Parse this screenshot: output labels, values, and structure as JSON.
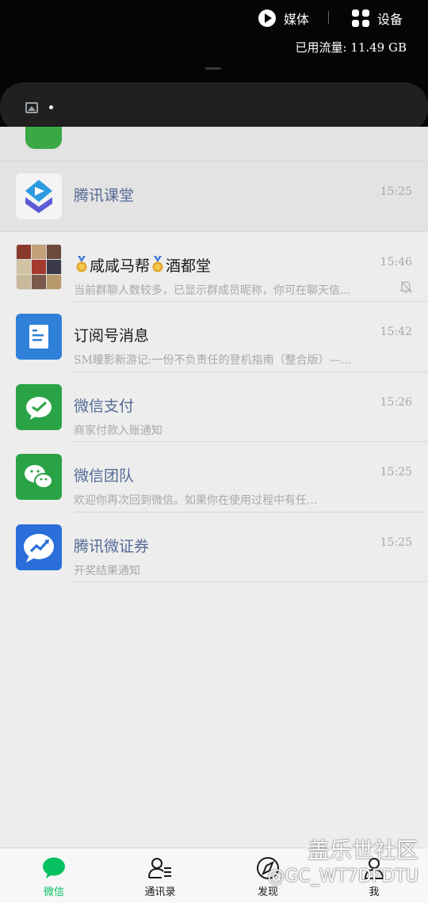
{
  "quick_panel": {
    "media_label": "媒体",
    "device_label": "设备",
    "traffic_text": "已用流量: 11.49 GB"
  },
  "chats": [
    {
      "title": "腾讯课堂",
      "time": "15:25",
      "preview": "",
      "title_style": "service",
      "pinned": true,
      "avatar": "tencent-classroom-icon"
    },
    {
      "title": "咸咸马帮",
      "title_suffix": "酒都堂",
      "time": "15:46",
      "preview": "当前群聊人数较多，已显示群成员昵称，你可在聊天信...",
      "title_style": "normal",
      "muted": true,
      "avatar": "group-avatar-icon"
    },
    {
      "title": "订阅号消息",
      "time": "15:42",
      "preview": "SM瞳影新游记:一份不负责任的登机指南（整合版）—...",
      "title_style": "normal",
      "avatar": "subscription-icon"
    },
    {
      "title": "微信支付",
      "time": "15:26",
      "preview": "商家付款入账通知",
      "title_style": "service",
      "avatar": "wechat-pay-icon"
    },
    {
      "title": "微信团队",
      "time": "15:25",
      "preview": "欢迎你再次回到微信。如果你在使用过程中有任...",
      "title_style": "service",
      "avatar": "wechat-team-icon"
    },
    {
      "title": "腾讯微证券",
      "time": "15:25",
      "preview": "开奖结果通知",
      "title_style": "service",
      "avatar": "tencent-securities-icon"
    }
  ],
  "tabs": [
    {
      "label": "微信",
      "icon": "chat-bubble-icon",
      "active": true
    },
    {
      "label": "通讯录",
      "icon": "contacts-icon",
      "active": false
    },
    {
      "label": "发现",
      "icon": "compass-icon",
      "active": false
    },
    {
      "label": "我",
      "icon": "person-icon",
      "active": false
    }
  ],
  "watermark": {
    "line1": "盖乐世社区",
    "line2": "@GC_WT7DFDTU"
  },
  "colors": {
    "accent": "#07c160",
    "service_title": "#546a96",
    "muted_text": "#a8a8a8"
  }
}
